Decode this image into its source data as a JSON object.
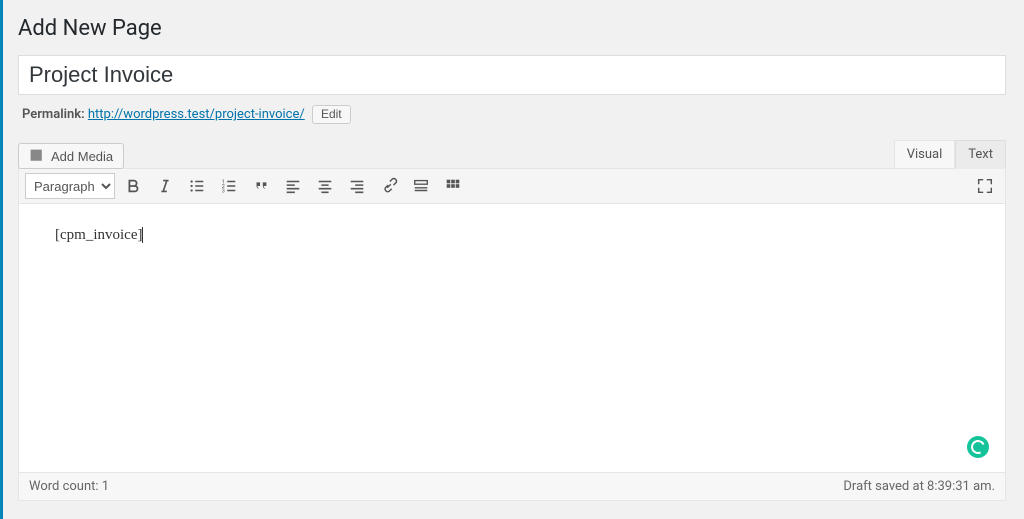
{
  "header": {
    "title": "Add New Page"
  },
  "title_input": {
    "value": "Project Invoice"
  },
  "permalink": {
    "label": "Permalink:",
    "url": "http://wordpress.test/project-invoice/",
    "edit_label": "Edit"
  },
  "media": {
    "add_label": "Add Media"
  },
  "tabs": {
    "visual": "Visual",
    "text": "Text"
  },
  "toolbar": {
    "format_value": "Paragraph"
  },
  "content": {
    "body": "[cpm_invoice]"
  },
  "status": {
    "wordcount_label": "Word count:",
    "wordcount": "1",
    "draft_saved": "Draft saved at 8:39:31 am."
  }
}
